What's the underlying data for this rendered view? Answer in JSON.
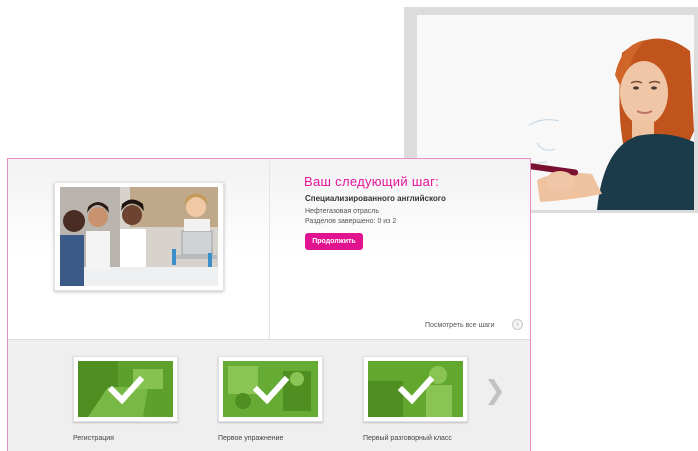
{
  "next_step": {
    "title": "Ваш следующий шаг:",
    "course": "Специализированного английского",
    "industry": "Нефтегазовая отрасль",
    "progress": "Разделов завершено: 0 из 2",
    "continue_label": "Продолжить"
  },
  "view_all": {
    "label": "Посмотреть все шаги",
    "icon": "circle-arrow-icon"
  },
  "steps": [
    {
      "label": "Регистрация",
      "icon": "checkmark-icon"
    },
    {
      "label": "Первое упражнение",
      "icon": "checkmark-icon"
    },
    {
      "label": "Первый разговорный класс",
      "icon": "checkmark-icon"
    }
  ],
  "carousel": {
    "next_icon": "chevron-right-icon",
    "next_glyph": "❯"
  },
  "colors": {
    "accent": "#e2138f",
    "panel_border": "#e58fc6",
    "step_green": "#62a82f"
  }
}
